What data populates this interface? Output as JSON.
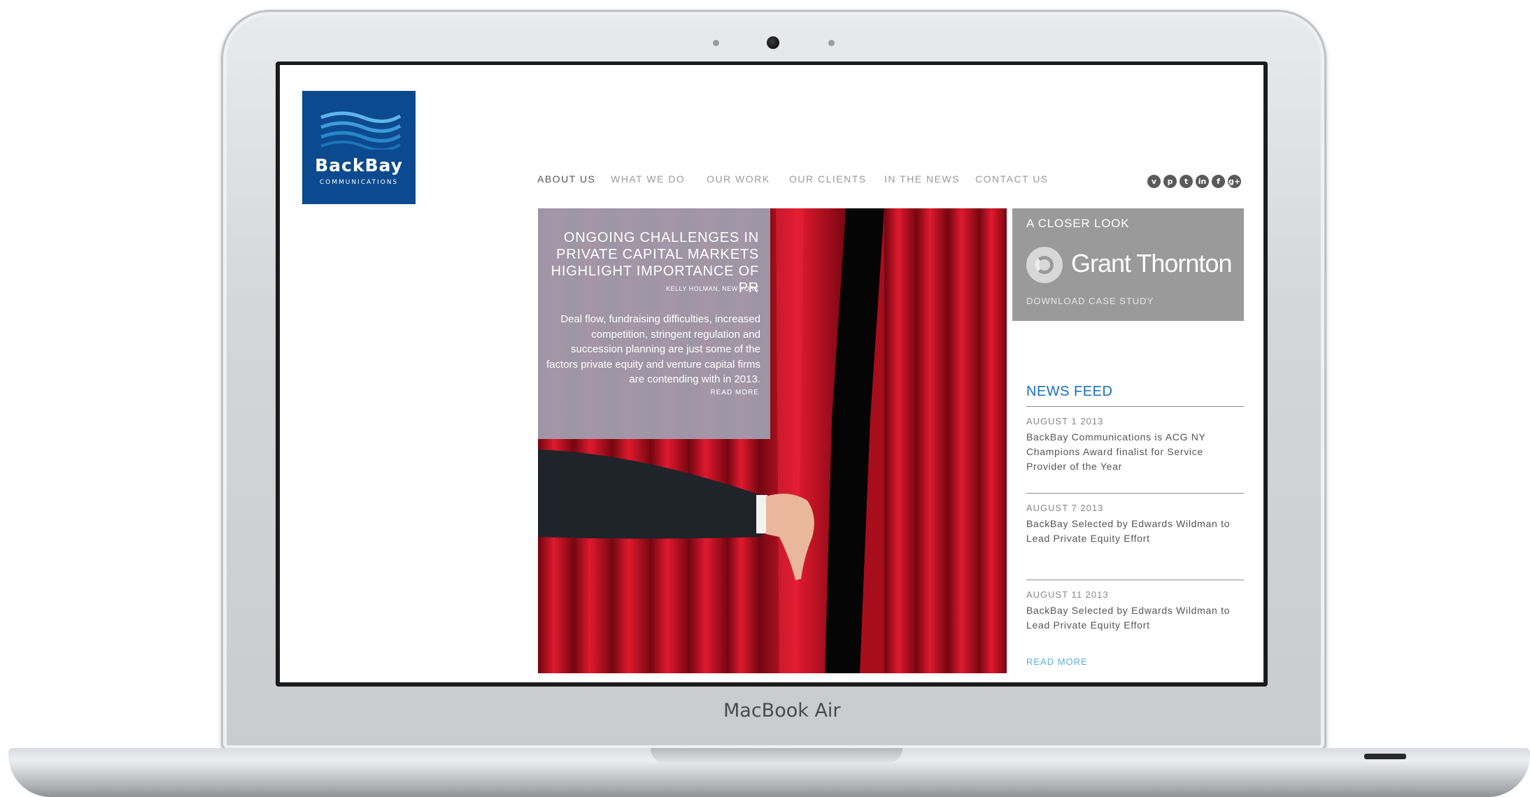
{
  "device": {
    "brand_label": "MacBook Air"
  },
  "site": {
    "logo": {
      "name": "BackBay",
      "subtitle": "COMMUNICATIONS"
    },
    "nav": [
      {
        "label": "ABOUT US",
        "active": true
      },
      {
        "label": "WHAT WE DO",
        "active": false
      },
      {
        "label": "OUR WORK",
        "active": false
      },
      {
        "label": "OUR CLIENTS",
        "active": false
      },
      {
        "label": "IN THE NEWS",
        "active": false
      },
      {
        "label": "CONTACT US",
        "active": false
      }
    ],
    "social": [
      {
        "icon": "vimeo-icon",
        "glyph": "v"
      },
      {
        "icon": "pinterest-icon",
        "glyph": "p"
      },
      {
        "icon": "twitter-icon",
        "glyph": "t"
      },
      {
        "icon": "linkedin-icon",
        "glyph": "in"
      },
      {
        "icon": "facebook-icon",
        "glyph": "f"
      },
      {
        "icon": "google-plus-icon",
        "glyph": "g+"
      }
    ],
    "feature": {
      "title": "ONGOING CHALLENGES IN PRIVATE CAPITAL MARKETS HIGHLIGHT IMPORTANCE OF PR",
      "byline": "KELLY HOLMAN, NEW YORK",
      "body": "Deal flow, fundraising difficulties, increased competition, stringent regulation and succession planning are just some of the factors private equity and venture capital firms are contending with in 2013.",
      "read_more": "READ MORE"
    },
    "closer_look": {
      "heading": "A CLOSER LOOK",
      "client_name": "Grant Thornton",
      "link": "DOWNLOAD CASE STUDY"
    },
    "news_feed": {
      "title": "NEWS FEED",
      "items": [
        {
          "date": "AUGUST 1 2013",
          "text": "BackBay Communications is ACG NY Champions Award finalist for Service Provider of the Year"
        },
        {
          "date": "AUGUST 7 2013",
          "text": "BackBay Selected by Edwards Wildman to Lead Private Equity Effort"
        },
        {
          "date": "AUGUST 11 2013",
          "text": "BackBay Selected by Edwards Wildman to Lead Private Equity Effort"
        }
      ],
      "read_more": "READ MORE"
    }
  },
  "colors": {
    "logo_blue": "#0b4a8e",
    "news_title_blue": "#1a6fbf",
    "link_blue": "#5bb1dc",
    "curtain_red": "#c8102e",
    "card_gray": "#9a9a9a"
  }
}
